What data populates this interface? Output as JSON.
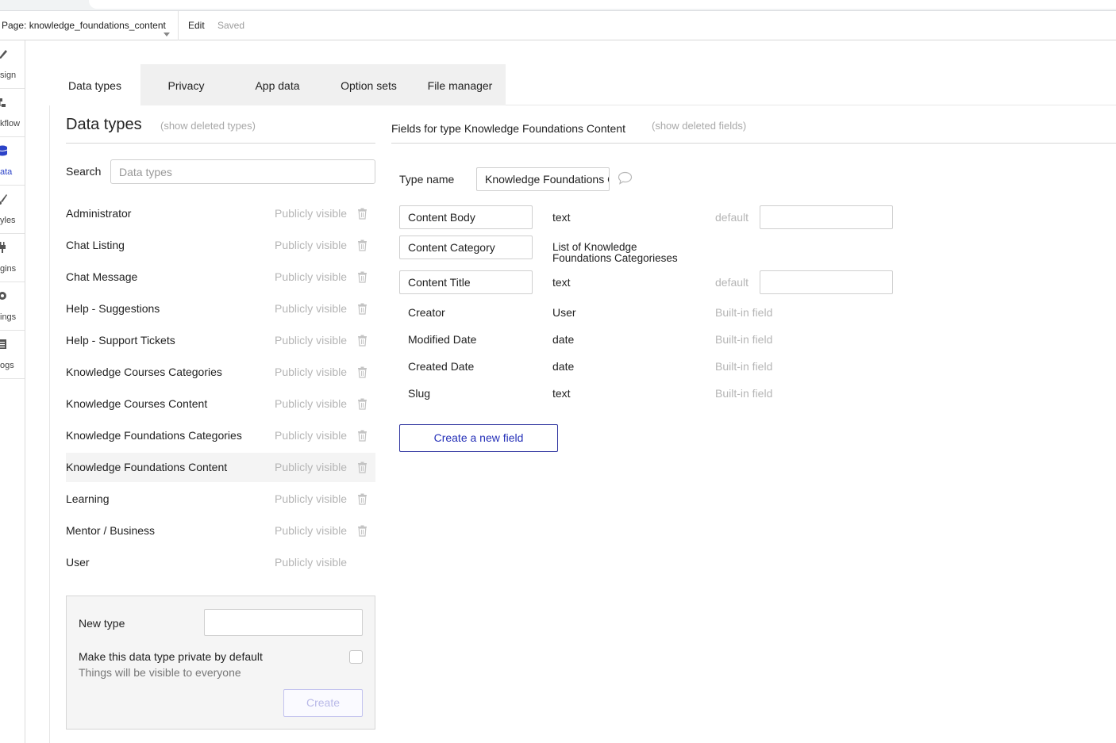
{
  "topbar": {
    "page_selector": "Page: knowledge_foundations_content",
    "edit": "Edit",
    "saved": "Saved"
  },
  "left_rail": {
    "items": [
      {
        "label": "sign",
        "icon": "design-icon"
      },
      {
        "label": "kflow",
        "icon": "workflow-icon"
      },
      {
        "label": "ata",
        "icon": "database-icon",
        "active": true
      },
      {
        "label": "yles",
        "icon": "brush-icon"
      },
      {
        "label": "gins",
        "icon": "plug-icon"
      },
      {
        "label": "ings",
        "icon": "gear-icon"
      },
      {
        "label": "ogs",
        "icon": "logs-icon"
      }
    ]
  },
  "tabs": [
    {
      "label": "Data types",
      "active": true
    },
    {
      "label": "Privacy"
    },
    {
      "label": "App data"
    },
    {
      "label": "Option sets"
    },
    {
      "label": "File manager"
    }
  ],
  "data_types": {
    "title": "Data types",
    "show_deleted": "(show deleted types)",
    "search_label": "Search",
    "search_placeholder": "Data types",
    "items": [
      {
        "name": "Administrator",
        "visibility": "Publicly visible",
        "deletable": true
      },
      {
        "name": "Chat Listing",
        "visibility": "Publicly visible",
        "deletable": true
      },
      {
        "name": "Chat Message",
        "visibility": "Publicly visible",
        "deletable": true
      },
      {
        "name": "Help - Suggestions",
        "visibility": "Publicly visible",
        "deletable": true
      },
      {
        "name": "Help - Support Tickets",
        "visibility": "Publicly visible",
        "deletable": true
      },
      {
        "name": "Knowledge Courses Categories",
        "visibility": "Publicly visible",
        "deletable": true
      },
      {
        "name": "Knowledge Courses Content",
        "visibility": "Publicly visible",
        "deletable": true
      },
      {
        "name": "Knowledge Foundations Categories",
        "visibility": "Publicly visible",
        "deletable": true
      },
      {
        "name": "Knowledge Foundations Content",
        "visibility": "Publicly visible",
        "deletable": true,
        "selected": true
      },
      {
        "name": "Learning",
        "visibility": "Publicly visible",
        "deletable": true
      },
      {
        "name": "Mentor / Business",
        "visibility": "Publicly visible",
        "deletable": true
      },
      {
        "name": "User",
        "visibility": "Publicly visible",
        "deletable": false
      }
    ]
  },
  "new_type": {
    "label": "New type",
    "private_label": "Make this data type private by default",
    "private_sub": "Things will be visible to everyone",
    "create": "Create"
  },
  "fields": {
    "title": "Fields for type Knowledge Foundations Content",
    "show_deleted": "(show deleted fields)",
    "type_name_label": "Type name",
    "type_name_value": "Knowledge Foundations Content",
    "default_label": "default",
    "rows": [
      {
        "name": "Content Body",
        "type": "text",
        "editable": true,
        "default": true
      },
      {
        "name": "Content Category",
        "type_line1": "List of Knowledge",
        "type_line2": "Foundations Categorieses",
        "editable": true
      },
      {
        "name": "Content Title",
        "type": "text",
        "editable": true,
        "default": true
      },
      {
        "name": "Creator",
        "type": "User",
        "builtin": "Built-in field"
      },
      {
        "name": "Modified Date",
        "type": "date",
        "builtin": "Built-in field"
      },
      {
        "name": "Created Date",
        "type": "date",
        "builtin": "Built-in field"
      },
      {
        "name": "Slug",
        "type": "text",
        "builtin": "Built-in field"
      }
    ],
    "create_button": "Create a new field"
  },
  "colors": {
    "accent": "#2c43c8",
    "muted": "#b5b5b5",
    "border": "#cfcfcf"
  }
}
